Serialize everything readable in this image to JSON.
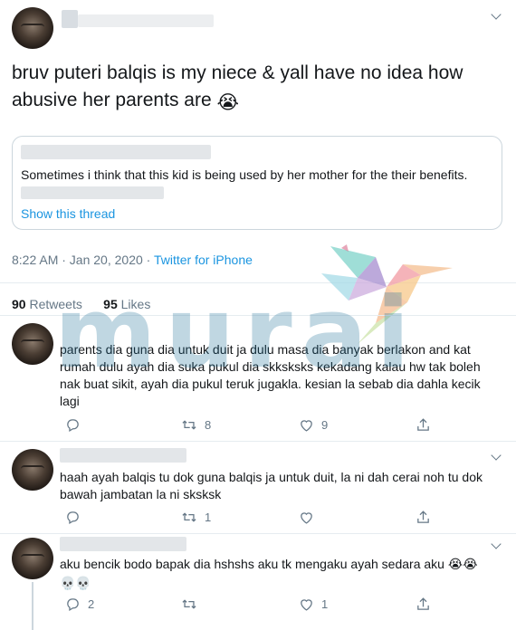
{
  "tweet": {
    "text": "bruv puteri balqis is my niece & yall have no idea how abusive her parents are",
    "emoji": "😭",
    "quoted": {
      "text": "Sometimes i think that this kid is being used by her mother for the their benefits.",
      "show_thread": "Show this thread"
    },
    "time": "8:22 AM · Jan 20, 2020 · ",
    "source": "Twitter for iPhone",
    "retweets_count": "90",
    "retweets_label": "Retweets",
    "likes_count": "95",
    "likes_label": "Likes"
  },
  "watermark": "murai",
  "replies": [
    {
      "text": "parents dia guna dia untuk duit ja dulu masa dia banyak berlakon and kat rumah dulu ayah dia suka pukul dia skksksks kekadang kalau hw tak boleh nak buat sikit, ayah dia pukul teruk jugakla. kesian la sebab dia dahla kecik lagi",
      "reply_count": "",
      "retweet_count": "8",
      "like_count": "9"
    },
    {
      "text": "haah ayah balqis tu dok guna balqis ja untuk duit, la ni dah cerai noh tu dok bawah jambatan la ni sksksk",
      "reply_count": "",
      "retweet_count": "1",
      "like_count": ""
    },
    {
      "text": "aku bencik bodo bapak dia hshshs aku tk mengaku ayah sedara aku",
      "emojis_inline": "😭😭",
      "emojis_line2": "💀💀",
      "reply_count": "2",
      "retweet_count": "",
      "like_count": "1"
    }
  ],
  "icons": [
    "chevron-down-icon",
    "reply-icon",
    "retweet-icon",
    "like-icon",
    "share-icon",
    "hummingbird-logo"
  ],
  "colors": {
    "link": "#1b95e0",
    "secondary": "#657786",
    "border": "#e6ecf0"
  }
}
